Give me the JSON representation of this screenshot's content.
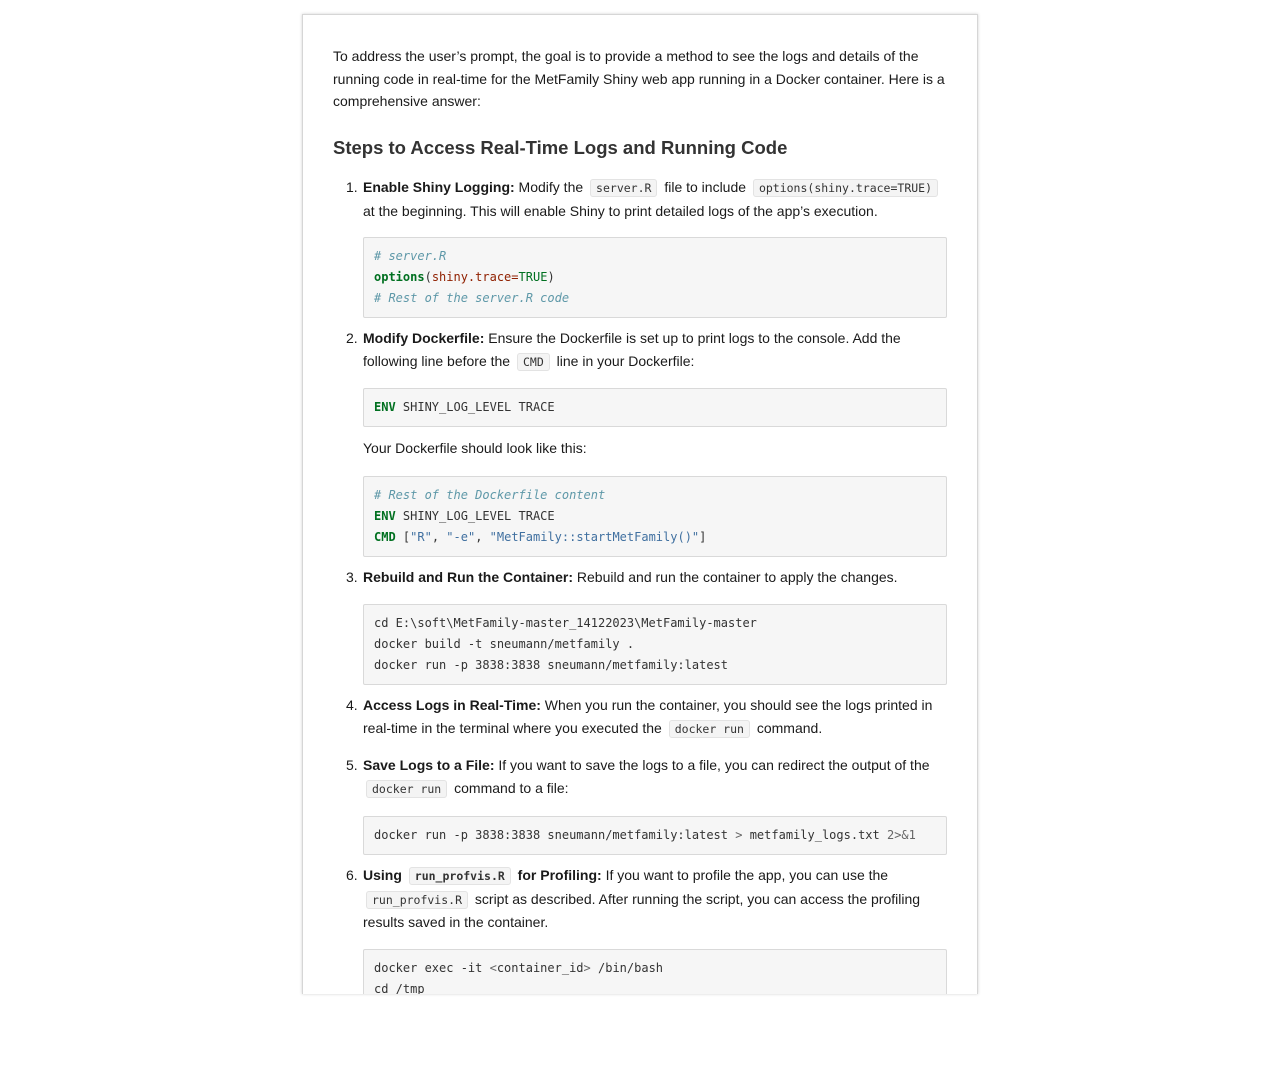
{
  "intro": "To address the user’s prompt, the goal is to provide a method to see the logs and details of the running code in real-time for the MetFamily Shiny web app running in a Docker container. Here is a comprehensive answer:",
  "heading": "Steps to Access Real-Time Logs and Running Code",
  "steps": [
    {
      "num": "1.",
      "title": "Enable Shiny Logging:",
      "t1": " Modify the ",
      "code1": "server.R",
      "t2": " file to include ",
      "code2": "options(shiny.trace=TRUE)",
      "t3": " at the beginning. This will enable Shiny to print detailed logs of the app’s execution."
    },
    {
      "num": "2.",
      "title": "Modify Dockerfile:",
      "t1": " Ensure the Dockerfile is set up to print logs to the console. Add the following line before the ",
      "code1": "CMD",
      "t2": " line in your Dockerfile:"
    },
    {
      "num": "3.",
      "title": "Rebuild and Run the Container:",
      "t1": " Rebuild and run the container to apply the changes."
    },
    {
      "num": "4.",
      "title": "Access Logs in Real-Time:",
      "t1": " When you run the container, you should see the logs printed in real-time in the terminal where you executed the ",
      "code1": "docker run",
      "t2": " command."
    },
    {
      "num": "5.",
      "title": "Save Logs to a File:",
      "t1": " If you want to save the logs to a file, you can redirect the output of the ",
      "code1": "docker run",
      "t2": " command to a file:"
    },
    {
      "num": "6.",
      "title_pre": "Using ",
      "title_code": "run_profvis.R",
      "title_post": " for Profiling:",
      "t1": " If you want to profile the app, you can use the ",
      "code1": "run_profvis.R",
      "t2": " script as described. After running the script, you can access the profiling results saved in the container."
    }
  ],
  "dockerfile_note": "Your Dockerfile should look like this:",
  "code_blocks": {
    "server_r": {
      "l1": "# server.R",
      "l2_fn": "options",
      "l2_p1": "(",
      "l2_arg": "shiny.trace",
      "l2_eq": "=",
      "l2_val": "TRUE",
      "l2_p2": ")",
      "l3": "# Rest of the server.R code"
    },
    "env_line": {
      "kw": "ENV",
      "rest": " SHINY_LOG_LEVEL TRACE"
    },
    "dockerfile": {
      "l1": "# Rest of the Dockerfile content",
      "l2_kw": "ENV",
      "l2_rest": " SHINY_LOG_LEVEL TRACE",
      "l3_kw": "CMD",
      "l3_b1": " [",
      "l3_s1": "\"R\"",
      "l3_c1": ", ",
      "l3_s2": "\"-e\"",
      "l3_c2": ", ",
      "l3_s3": "\"MetFamily::startMetFamily()\"",
      "l3_b2": "]"
    },
    "rebuild": {
      "l1": "cd E:\\soft\\MetFamily-master_14122023\\MetFamily-master",
      "l2": "docker build -t sneumann/metfamily .",
      "l3": "docker run -p 3838:3838 sneumann/metfamily:latest"
    },
    "save_logs": {
      "a": "docker run -p 3838:3838 sneumann/metfamily:latest ",
      "op": ">",
      "b": " metfamily_logs.txt ",
      "c": "2>&1"
    },
    "exec": {
      "l1a": "docker exec -it ",
      "l1op1": "<",
      "l1b": "container_id",
      "l1op2": ">",
      "l1c": " /bin/bash",
      "l2": "cd /tmp"
    }
  }
}
